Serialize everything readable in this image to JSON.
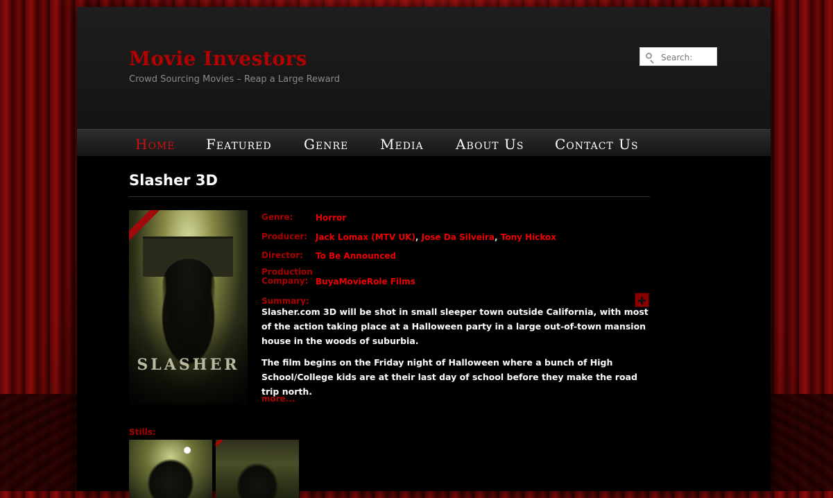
{
  "site": {
    "title": "Movie Investors",
    "description": "Crowd Sourcing Movies – Reap a Large Reward"
  },
  "search": {
    "placeholder": "Search:"
  },
  "nav": {
    "items": [
      {
        "label": "Home",
        "active": true
      },
      {
        "label": "Featured",
        "active": false
      },
      {
        "label": "Genre",
        "active": false
      },
      {
        "label": "Media",
        "active": false
      },
      {
        "label": "About Us",
        "active": false
      },
      {
        "label": "Contact Us",
        "active": false
      }
    ]
  },
  "movie": {
    "title": "Slasher 3D",
    "poster_title": "SLASHER",
    "fields": {
      "genre_label": "Genre:",
      "genre_value": "Horror",
      "producer_label": "Producer:",
      "producers": [
        "Jack Lomax (MTV UK)",
        "Jose Da Silveira",
        "Tony Hickox"
      ],
      "producer_separator": ", ",
      "director_label": "Director:",
      "director_value": "To Be Announced",
      "company_label_1": "Production",
      "company_label_2": "Company:",
      "company_value": "BuyaMovieRole Films"
    },
    "summary_label": "Summary:",
    "summary": [
      "Slasher.com 3D will be shot in small sleeper town outside California, with most of the action taking place at a Halloween party in a large out-of-town mansion house in the woods of suburbia.",
      "The film begins on the Friday night of Halloween where a bunch of High School/College kids are at their last day of school before they make the road trip north."
    ],
    "more_label": "more...",
    "stills_label": "Stills:"
  },
  "colors": {
    "accent": "#b30000",
    "link": "#ee0000",
    "background": "#000000"
  },
  "icons": {
    "search": "search-icon",
    "expand": "plus-icon"
  }
}
